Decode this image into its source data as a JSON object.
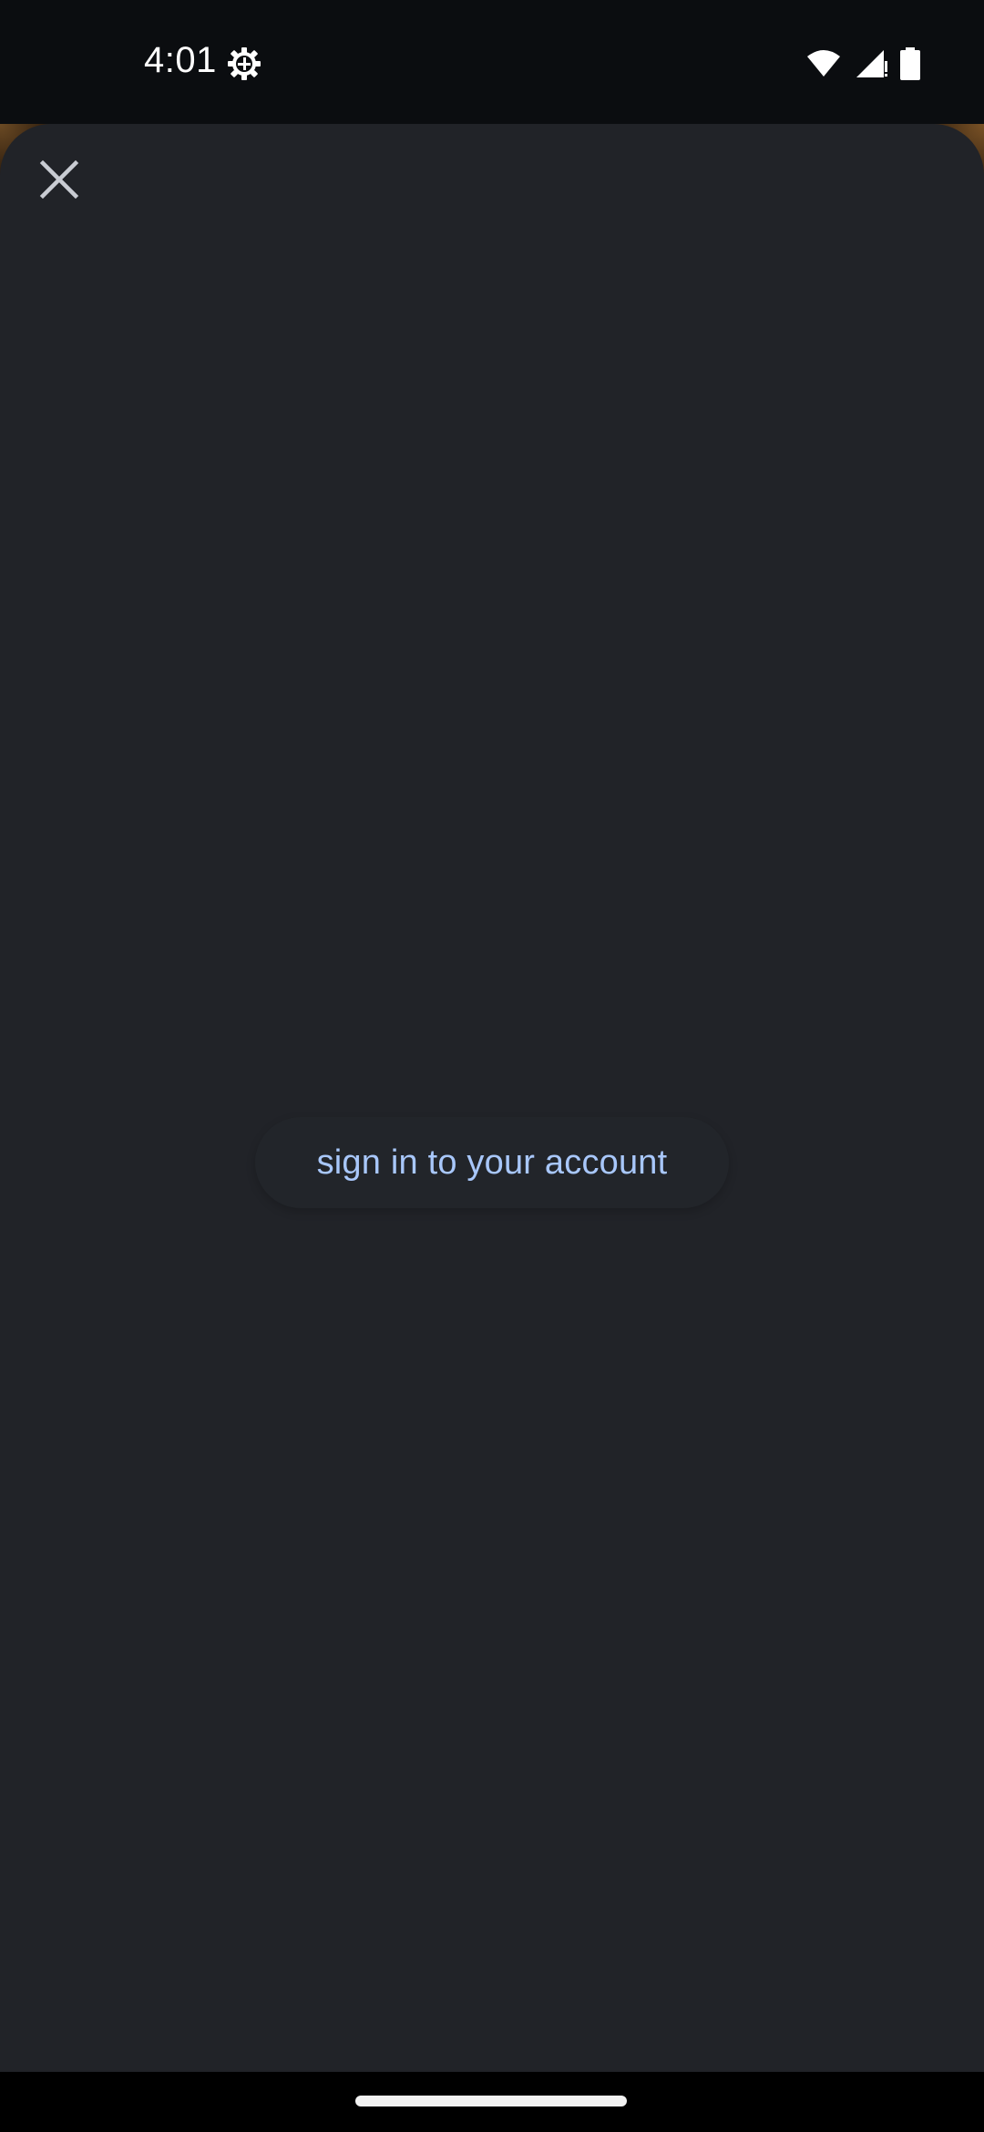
{
  "status_bar": {
    "time": "4:01",
    "icons": [
      "gear-icon",
      "wifi-icon",
      "signal-icon",
      "battery-icon"
    ]
  },
  "sheet": {
    "close_icon": "close-icon",
    "signin_label": "sign in to your account"
  },
  "colors": {
    "sheet_background": "#212328",
    "link_text": "#a8c7fa",
    "status_bar_background": "#0b0d10"
  }
}
